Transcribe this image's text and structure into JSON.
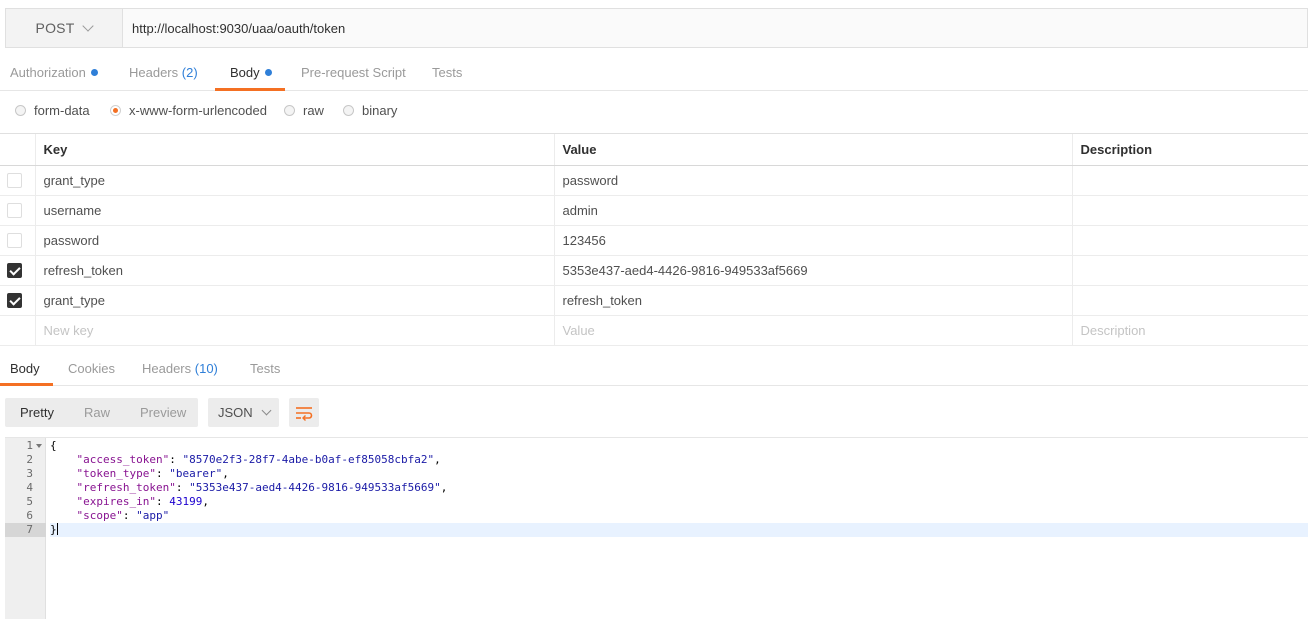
{
  "request": {
    "method": "POST",
    "url": "http://localhost:9030/uaa/oauth/token"
  },
  "request_tabs": [
    {
      "label": "Authorization",
      "dot": true
    },
    {
      "label": "Headers",
      "count": "(2)"
    },
    {
      "label": "Body",
      "dot": true,
      "active": true
    },
    {
      "label": "Pre-request Script"
    },
    {
      "label": "Tests"
    }
  ],
  "body_types": [
    {
      "label": "form-data",
      "selected": false
    },
    {
      "label": "x-www-form-urlencoded",
      "selected": true
    },
    {
      "label": "raw",
      "selected": false
    },
    {
      "label": "binary",
      "selected": false
    }
  ],
  "params": {
    "headers": {
      "key": "Key",
      "value": "Value",
      "description": "Description"
    },
    "rows": [
      {
        "checked": false,
        "key": "grant_type",
        "value": "password",
        "description": ""
      },
      {
        "checked": false,
        "key": "username",
        "value": "admin",
        "description": ""
      },
      {
        "checked": false,
        "key": "password",
        "value": "123456",
        "description": ""
      },
      {
        "checked": true,
        "key": "refresh_token",
        "value": "5353e437-aed4-4426-9816-949533af5669",
        "description": ""
      },
      {
        "checked": true,
        "key": "grant_type",
        "value": "refresh_token",
        "description": ""
      }
    ],
    "placeholders": {
      "key": "New key",
      "value": "Value",
      "description": "Description"
    }
  },
  "response_tabs": [
    {
      "label": "Body",
      "active": true
    },
    {
      "label": "Cookies"
    },
    {
      "label": "Headers",
      "count": "(10)"
    },
    {
      "label": "Tests"
    }
  ],
  "response_toolbar": {
    "views": [
      "Pretty",
      "Raw",
      "Preview"
    ],
    "active_view": "Pretty",
    "format": "JSON",
    "wrap_icon": "wrap-lines-icon"
  },
  "response_body": {
    "line_numbers": [
      "1",
      "2",
      "3",
      "4",
      "5",
      "6",
      "7"
    ],
    "open_brace": "{",
    "close_brace": "}",
    "fields": [
      {
        "key": "\"access_token\"",
        "value": "\"8570e2f3-28f7-4abe-b0af-ef85058cbfa2\"",
        "sep": ","
      },
      {
        "key": "\"token_type\"",
        "value": "\"bearer\"",
        "sep": ","
      },
      {
        "key": "\"refresh_token\"",
        "value": "\"5353e437-aed4-4426-9816-949533af5669\"",
        "sep": ","
      },
      {
        "key": "\"expires_in\"",
        "value": "43199",
        "sep": ","
      },
      {
        "key": "\"scope\"",
        "value": "\"app\"",
        "sep": ""
      }
    ]
  },
  "colors": {
    "accent": "#f47023",
    "link_blue": "#2f7fd8",
    "json_key": "#881391",
    "json_string": "#1a1aa6"
  }
}
